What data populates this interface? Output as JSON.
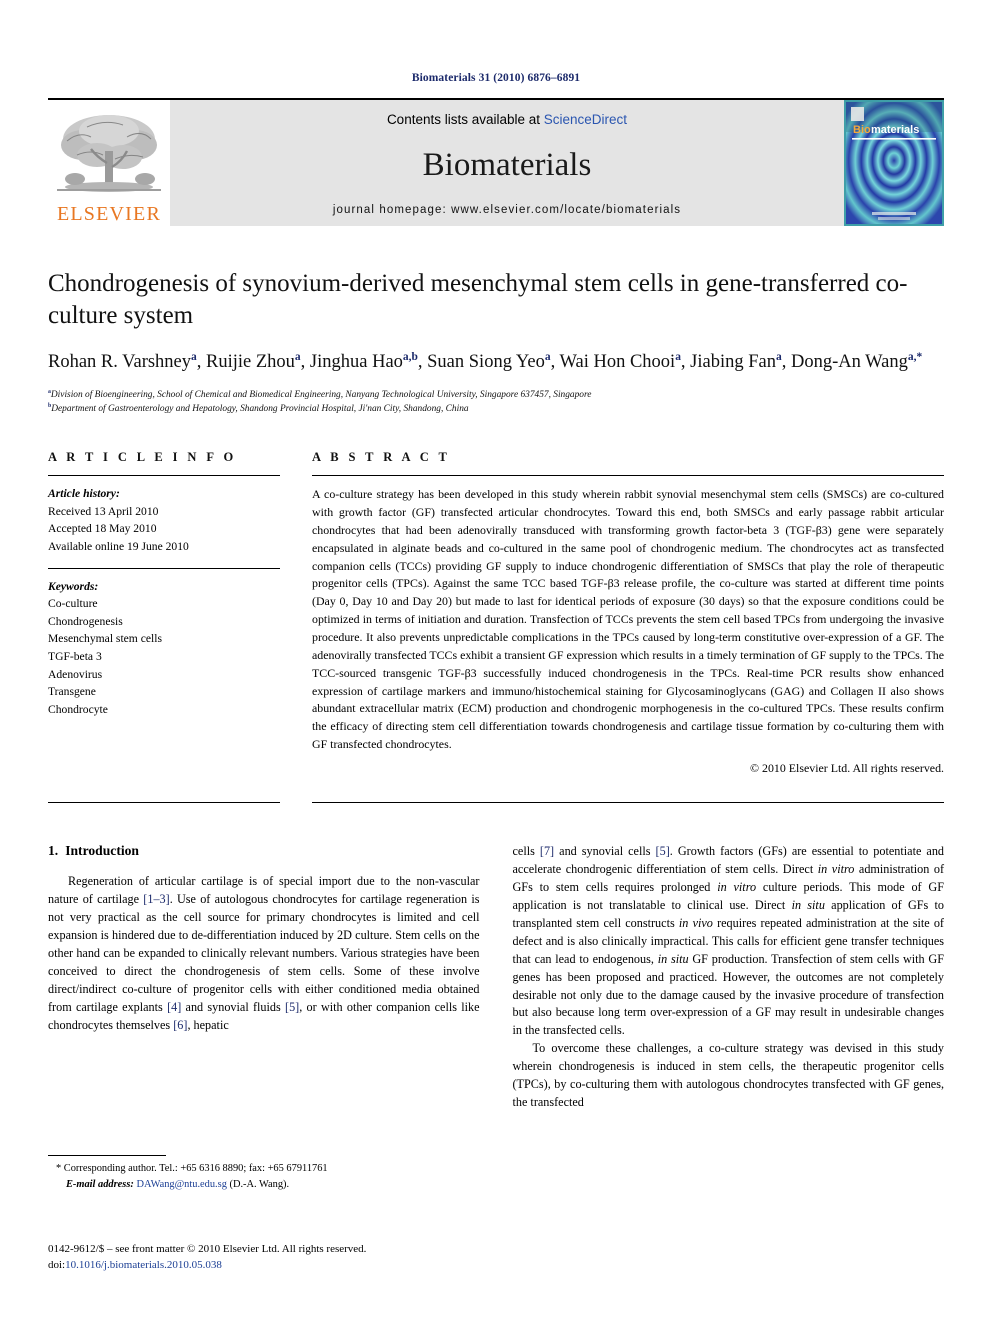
{
  "running_head": "Biomaterials 31 (2010) 6876–6891",
  "masthead": {
    "publisher_name": "ELSEVIER",
    "contents_prefix": "Contents lists available at ",
    "contents_link": "ScienceDirect",
    "journal_name": "Biomaterials",
    "homepage": "journal homepage: www.elsevier.com/locate/biomaterials",
    "cover_title_prefix": "Bio",
    "cover_title_suffix": "materials",
    "accent_color": "#e87722",
    "link_color": "#2b56b0"
  },
  "title": "Chondrogenesis of synovium-derived mesenchymal stem cells in gene-transferred co-culture system",
  "authors": [
    {
      "name": "Rohan R. Varshney",
      "sup": "a",
      "sep": ", "
    },
    {
      "name": "Ruijie Zhou",
      "sup": "a",
      "sep": ", "
    },
    {
      "name": "Jinghua Hao",
      "sup": "a,b",
      "sep": ", "
    },
    {
      "name": "Suan Siong Yeo",
      "sup": "a",
      "sep": ", "
    },
    {
      "name": "Wai Hon Chooi",
      "sup": "a",
      "sep": ", "
    },
    {
      "name": "Jiabing Fan",
      "sup": "a",
      "sep": ", "
    },
    {
      "name": "Dong-An Wang",
      "sup": "a,*",
      "sep": ""
    }
  ],
  "affiliations": [
    {
      "marker": "a",
      "text": "Division of Bioengineering, School of Chemical and Biomedical Engineering, Nanyang Technological University, Singapore 637457, Singapore"
    },
    {
      "marker": "b",
      "text": "Department of Gastroenterology and Hepatology, Shandong Provincial Hospital, Ji'nan City, Shandong, China"
    }
  ],
  "article_info": {
    "heading": "A R T I C L E   I N F O",
    "history_label": "Article history:",
    "history": [
      "Received 13 April 2010",
      "Accepted 18 May 2010",
      "Available online 19 June 2010"
    ],
    "keywords_label": "Keywords:",
    "keywords": [
      "Co-culture",
      "Chondrogenesis",
      "Mesenchymal stem cells",
      "TGF-beta 3",
      "Adenovirus",
      "Transgene",
      "Chondrocyte"
    ]
  },
  "abstract": {
    "heading": "A B S T R A C T",
    "text": "A co-culture strategy has been developed in this study wherein rabbit synovial mesenchymal stem cells (SMSCs) are co-cultured with growth factor (GF) transfected articular chondrocytes. Toward this end, both SMSCs and early passage rabbit articular chondrocytes that had been adenovirally transduced with transforming growth factor-beta 3 (TGF-β3) gene were separately encapsulated in alginate beads and co-cultured in the same pool of chondrogenic medium. The chondrocytes act as transfected companion cells (TCCs) providing GF supply to induce chondrogenic differentiation of SMSCs that play the role of therapeutic progenitor cells (TPCs). Against the same TCC based TGF-β3 release profile, the co-culture was started at different time points (Day 0, Day 10 and Day 20) but made to last for identical periods of exposure (30 days) so that the exposure conditions could be optimized in terms of initiation and duration. Transfection of TCCs prevents the stem cell based TPCs from undergoing the invasive procedure. It also prevents unpredictable complications in the TPCs caused by long-term constitutive over-expression of a GF. The adenovirally transfected TCCs exhibit a transient GF expression which results in a timely termination of GF supply to the TPCs. The TCC-sourced transgenic TGF-β3 successfully induced chondrogenesis in the TPCs. Real-time PCR results show enhanced expression of cartilage markers and immuno/histochemical staining for Glycosaminoglycans (GAG) and Collagen II also shows abundant extracellular matrix (ECM) production and chondrogenic morphogenesis in the co-cultured TPCs. These results confirm the efficacy of directing stem cell differentiation towards chondrogenesis and cartilage tissue formation by co-culturing them with GF transfected chondrocytes.",
    "copyright": "© 2010 Elsevier Ltd. All rights reserved."
  },
  "introduction": {
    "number": "1.",
    "title": "Introduction"
  },
  "footnotes": {
    "corresponding": "* Corresponding author. Tel.: +65 6316 8890; fax: +65 67911761",
    "email_label": "E-mail address:",
    "email": "DAWang@ntu.edu.sg",
    "email_owner": "(D.-A. Wang).",
    "imprint": "0142-9612/$ – see front matter © 2010 Elsevier Ltd. All rights reserved.",
    "doi_label": "doi:",
    "doi": "10.1016/j.biomaterials.2010.05.038"
  }
}
